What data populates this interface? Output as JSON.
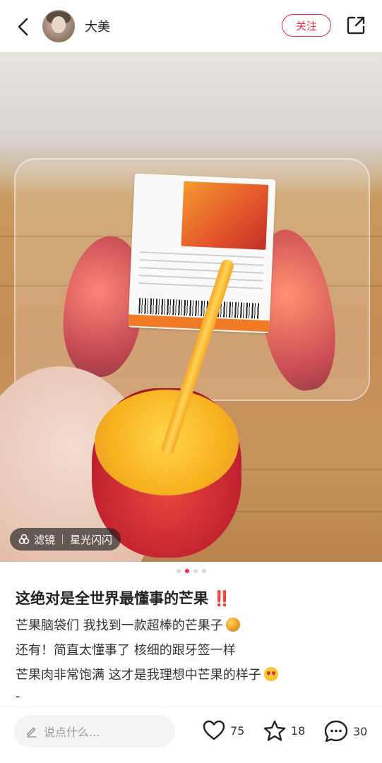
{
  "header": {
    "username": "大美",
    "follow_label": "关注"
  },
  "photo": {
    "filter_label": "滤镜",
    "filter_name": "星光闪闪",
    "page_count": 4,
    "current_page": 2
  },
  "post": {
    "title": "这绝对是全世界最懂事的芒果",
    "title_suffix": "‼️",
    "lines": [
      "芒果脑袋们 我找到一款超棒的芒果子",
      "还有！简直太懂事了 核细的跟牙签一样",
      "芒果肉非常饱满 这才是我理想中芒果的样子"
    ],
    "tail": "-"
  },
  "bottom": {
    "comment_placeholder": "说点什么...",
    "likes": "75",
    "collects": "18",
    "comments": "30"
  },
  "colors": {
    "accent": "#ff2442"
  }
}
